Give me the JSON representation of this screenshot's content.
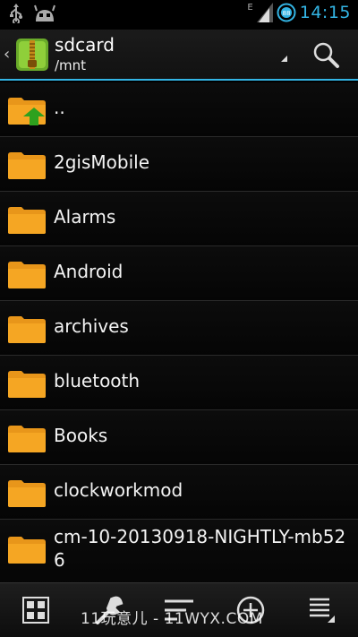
{
  "status": {
    "time": "14:15",
    "network": "E",
    "icons": [
      "usb-icon",
      "android-debug-icon",
      "signal-icon",
      "battery-icon"
    ]
  },
  "actionbar": {
    "title": "sdcard",
    "subtitle": "/mnt",
    "icons": [
      "up-caret-icon",
      "app-zip-icon",
      "dropdown-icon",
      "search-icon"
    ]
  },
  "files": [
    {
      "name": "..",
      "type": "parent"
    },
    {
      "name": "2gisMobile",
      "type": "folder"
    },
    {
      "name": "Alarms",
      "type": "folder"
    },
    {
      "name": "Android",
      "type": "folder"
    },
    {
      "name": "archives",
      "type": "folder"
    },
    {
      "name": "bluetooth",
      "type": "folder"
    },
    {
      "name": "Books",
      "type": "folder"
    },
    {
      "name": "clockworkmod",
      "type": "folder"
    },
    {
      "name": "cm-10-20130918-NIGHTLY-mb526",
      "type": "folder"
    }
  ],
  "bottombar": {
    "buttons": [
      "grid-view-icon",
      "tools-wrench-icon",
      "sort-icon",
      "add-icon",
      "menu-list-icon"
    ],
    "watermark": "11玩意儿 - 11WYX.COM"
  },
  "colors": {
    "accent": "#33b5e5",
    "folder": "#f0a020",
    "up_arrow": "#2ea11e"
  }
}
